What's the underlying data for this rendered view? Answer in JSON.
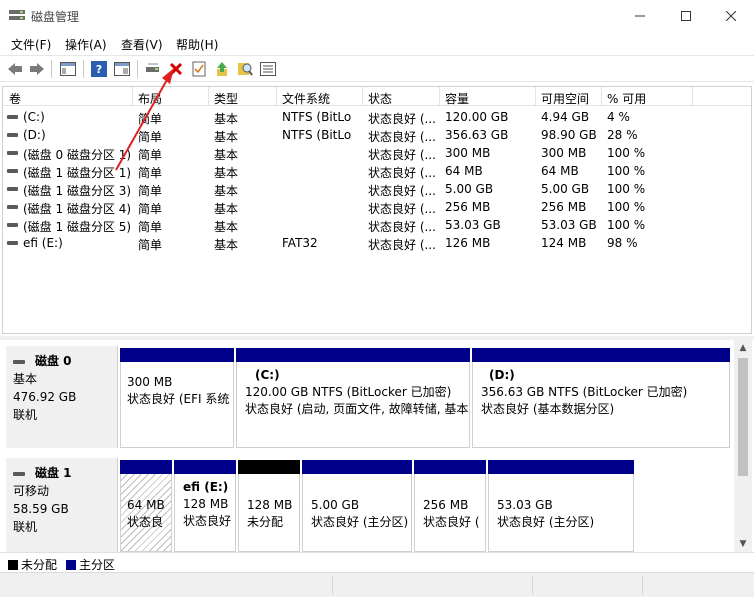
{
  "window": {
    "title": "磁盘管理",
    "minimize_icon": "minimize-icon",
    "maximize_icon": "maximize-icon",
    "close_icon": "close-icon"
  },
  "menu": [
    "文件(F)",
    "操作(A)",
    "查看(V)",
    "帮助(H)"
  ],
  "toolbar": {
    "buttons": [
      "back-icon",
      "forward-icon",
      "console-tree-icon",
      "help-icon",
      "action-pane-icon",
      "connect-disk-icon",
      "delete-icon",
      "properties-icon",
      "refresh-icon",
      "rescan-icon",
      "volume-list-icon"
    ],
    "delete_color": "#d40000"
  },
  "volume_list": {
    "headers": [
      "卷",
      "布局",
      "类型",
      "文件系统",
      "状态",
      "容量",
      "可用空间",
      "% 可用"
    ],
    "rows": [
      [
        "(C:)",
        "简单",
        "基本",
        "NTFS (BitLo",
        "状态良好 (...",
        "120.00 GB",
        "4.94 GB",
        "4 %"
      ],
      [
        "(D:)",
        "简单",
        "基本",
        "NTFS (BitLo",
        "状态良好 (...",
        "356.63 GB",
        "98.90 GB",
        "28 %"
      ],
      [
        "(磁盘 0 磁盘分区 1)",
        "简单",
        "基本",
        "",
        "状态良好 (...",
        "300 MB",
        "300 MB",
        "100 %"
      ],
      [
        "(磁盘 1 磁盘分区 1)",
        "简单",
        "基本",
        "",
        "状态良好 (...",
        "64 MB",
        "64 MB",
        "100 %"
      ],
      [
        "(磁盘 1 磁盘分区 3)",
        "简单",
        "基本",
        "",
        "状态良好 (...",
        "5.00 GB",
        "5.00 GB",
        "100 %"
      ],
      [
        "(磁盘 1 磁盘分区 4)",
        "简单",
        "基本",
        "",
        "状态良好 (...",
        "256 MB",
        "256 MB",
        "100 %"
      ],
      [
        "(磁盘 1 磁盘分区 5)",
        "简单",
        "基本",
        "",
        "状态良好 (...",
        "53.03 GB",
        "53.03 GB",
        "100 %"
      ],
      [
        "efi (E:)",
        "简单",
        "基本",
        "FAT32",
        "状态良好 (...",
        "126 MB",
        "124 MB",
        "98 %"
      ]
    ]
  },
  "disks": [
    {
      "name": "磁盘 0",
      "type": "基本",
      "size": "476.92 GB",
      "status": "联机",
      "partitions": [
        {
          "label": "",
          "size": "300 MB",
          "status": "状态良好 (EFI 系统",
          "kind": "primary"
        },
        {
          "label": "(C:)",
          "size": "120.00 GB NTFS (BitLocker 已加密)",
          "status": "状态良好 (启动, 页面文件, 故障转储, 基本",
          "kind": "primary"
        },
        {
          "label": "(D:)",
          "size": "356.63 GB NTFS (BitLocker 已加密)",
          "status": "状态良好 (基本数据分区)",
          "kind": "primary"
        }
      ]
    },
    {
      "name": "磁盘 1",
      "type": "可移动",
      "size": "58.59 GB",
      "status": "联机",
      "partitions": [
        {
          "label": "",
          "size": "64 MB",
          "status": "状态良",
          "kind": "primary-selected"
        },
        {
          "label": "efi (E:)",
          "size": "128 MB",
          "status": "状态良好",
          "kind": "primary"
        },
        {
          "label": "",
          "size": "128 MB",
          "status": "未分配",
          "kind": "unallocated"
        },
        {
          "label": "",
          "size": "5.00 GB",
          "status": "状态良好 (主分区)",
          "kind": "primary"
        },
        {
          "label": "",
          "size": "256 MB",
          "status": "状态良好 (",
          "kind": "primary"
        },
        {
          "label": "",
          "size": "53.03 GB",
          "status": "状态良好 (主分区)",
          "kind": "primary"
        }
      ]
    }
  ],
  "legend": [
    {
      "label": "未分配",
      "color": "#000000"
    },
    {
      "label": "主分区",
      "color": "#00008b"
    }
  ],
  "colors": {
    "primary_partition": "#00008b",
    "unallocated": "#000000",
    "annotation_arrow": "#e02020"
  }
}
